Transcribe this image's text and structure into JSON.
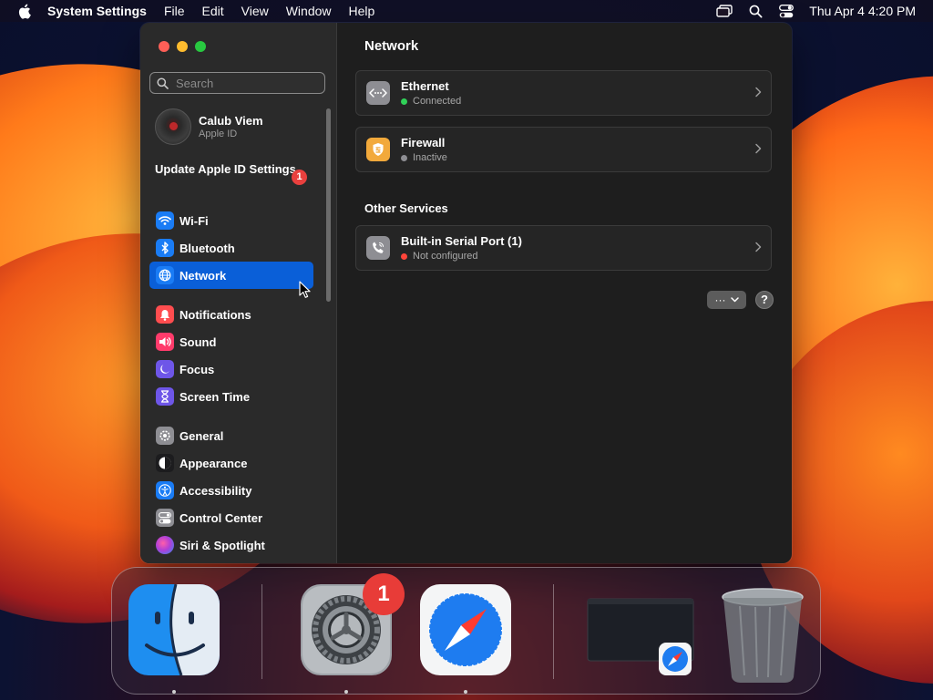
{
  "menubar": {
    "app_name": "System Settings",
    "menus": [
      "File",
      "Edit",
      "View",
      "Window",
      "Help"
    ],
    "clock": "Thu Apr 4  4:20 PM",
    "icons": [
      "apple-icon",
      "screen-mirroring-icon",
      "spotlight-search-icon",
      "control-center-icon"
    ]
  },
  "window": {
    "title": "Network",
    "search": {
      "placeholder": "Search",
      "value": ""
    },
    "account": {
      "name": "Calub Viem",
      "subtitle": "Apple ID"
    },
    "update": {
      "label": "Update Apple ID Settings",
      "badge": "1"
    },
    "sidebar": [
      {
        "label": "Wi-Fi",
        "icon": "wifi-icon",
        "color": "#1a7cf5"
      },
      {
        "label": "Bluetooth",
        "icon": "bluetooth-icon",
        "color": "#1a7cf5"
      },
      {
        "label": "Network",
        "icon": "globe-icon",
        "color": "#1a7cf5",
        "selected": true
      },
      {
        "label": "Notifications",
        "icon": "bell-icon",
        "color": "#ff4d4f"
      },
      {
        "label": "Sound",
        "icon": "speaker-icon",
        "color": "#ff3b6b"
      },
      {
        "label": "Focus",
        "icon": "moon-icon",
        "color": "#6e56e8"
      },
      {
        "label": "Screen Time",
        "icon": "hourglass-icon",
        "color": "#6e56e8"
      },
      {
        "label": "General",
        "icon": "gear-icon",
        "color": "#8e8e93"
      },
      {
        "label": "Appearance",
        "icon": "appearance-icon",
        "color": "#1c1c1e"
      },
      {
        "label": "Accessibility",
        "icon": "accessibility-icon",
        "color": "#1a7cf5"
      },
      {
        "label": "Control Center",
        "icon": "control-center-icon",
        "color": "#8e8e93"
      },
      {
        "label": "Siri & Spotlight",
        "icon": "siri-icon",
        "color": "#b23fd6"
      }
    ],
    "services": [
      {
        "name": "Ethernet",
        "status": "Connected",
        "status_color": "#30d158",
        "icon": "ethernet-icon"
      },
      {
        "name": "Firewall",
        "status": "Inactive",
        "status_color": "#8e8e93",
        "icon": "firewall-icon"
      }
    ],
    "other_services_title": "Other Services",
    "other_services": [
      {
        "name": "Built-in Serial Port (1)",
        "status": "Not configured",
        "status_color": "#ff453a",
        "icon": "phone-icon"
      }
    ],
    "more_button": "···",
    "help_button": "?"
  },
  "dock": {
    "apps": [
      {
        "name": "Finder",
        "icon": "finder-icon",
        "running": true
      },
      {
        "name": "System Settings",
        "icon": "system-settings-icon",
        "running": true,
        "badge": "1"
      },
      {
        "name": "Safari",
        "icon": "safari-icon",
        "running": true
      },
      {
        "name": "Safari Window",
        "icon": "minimized-window-icon",
        "running": false
      },
      {
        "name": "Trash",
        "icon": "trash-icon",
        "running": false
      }
    ]
  }
}
